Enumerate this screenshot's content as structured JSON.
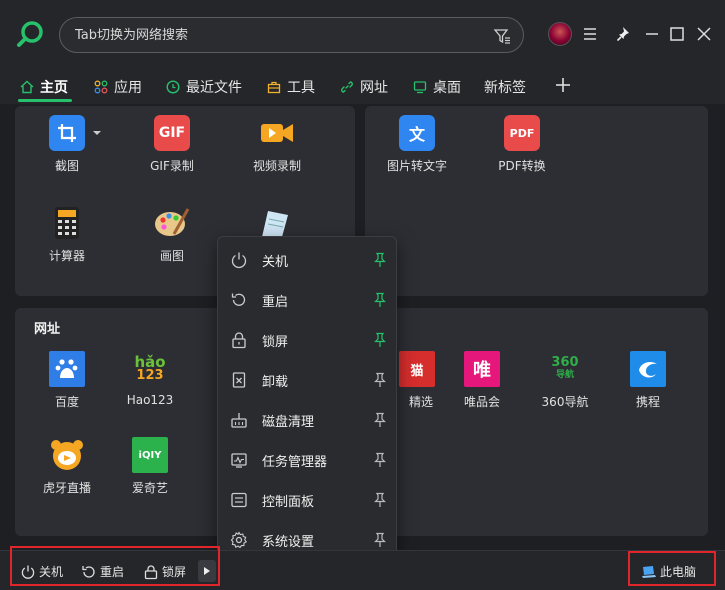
{
  "search": {
    "placeholder": "Tab切换为网络搜索"
  },
  "tabs": [
    {
      "label": "主页",
      "icon": "home-icon"
    },
    {
      "label": "应用",
      "icon": "apps-icon"
    },
    {
      "label": "最近文件",
      "icon": "clock-icon"
    },
    {
      "label": "工具",
      "icon": "toolbox-icon"
    },
    {
      "label": "网址",
      "icon": "link-icon"
    },
    {
      "label": "桌面",
      "icon": "desktop-icon"
    },
    {
      "label": "新标签"
    }
  ],
  "tools_panel": {
    "apps": [
      {
        "label": "截图",
        "icon": "crop-icon"
      },
      {
        "label": "GIF录制",
        "icon": "gif-icon",
        "badge": "GIF"
      },
      {
        "label": "视频录制",
        "icon": "video-camera-icon"
      },
      {
        "label": "计算器",
        "icon": "calculator-icon"
      },
      {
        "label": "画图",
        "icon": "palette-icon"
      }
    ]
  },
  "tools_panel_right": {
    "apps": [
      {
        "label": "图片转文字",
        "icon": "image-to-text-icon",
        "badge": "文"
      },
      {
        "label": "PDF转换",
        "icon": "pdf-icon",
        "badge": "PDF"
      }
    ]
  },
  "websites": {
    "title": "网址",
    "items": [
      {
        "label": "百度",
        "icon": "baidu-icon"
      },
      {
        "label": "Hao123",
        "icon": "hao123-icon",
        "badge_top": "hǎo",
        "badge_bottom": "123"
      },
      {
        "label": "精选",
        "icon": "tmall-icon",
        "badge": "猫"
      },
      {
        "label": "唯品会",
        "icon": "vip-icon",
        "badge": "唯"
      },
      {
        "label": "360导航",
        "icon": "360-nav-icon",
        "badge_top": "360",
        "badge_bottom": "导航"
      },
      {
        "label": "携程",
        "icon": "ctrip-icon"
      },
      {
        "label": "虎牙直播",
        "icon": "huya-icon"
      },
      {
        "label": "爱奇艺",
        "icon": "iqiyi-icon",
        "badge": "iQIY"
      }
    ]
  },
  "power_menu": {
    "items": [
      {
        "label": "关机",
        "icon": "power-icon",
        "pinned": true
      },
      {
        "label": "重启",
        "icon": "restart-icon",
        "pinned": true
      },
      {
        "label": "锁屏",
        "icon": "lock-icon",
        "pinned": true
      },
      {
        "label": "卸载",
        "icon": "uninstall-icon",
        "pinned": false
      },
      {
        "label": "磁盘清理",
        "icon": "disk-clean-icon",
        "pinned": false
      },
      {
        "label": "任务管理器",
        "icon": "task-manager-icon",
        "pinned": false
      },
      {
        "label": "控制面板",
        "icon": "control-panel-icon",
        "pinned": false
      },
      {
        "label": "系统设置",
        "icon": "settings-icon",
        "pinned": false
      }
    ]
  },
  "bottom_bar": {
    "shutdown": "关机",
    "restart": "重启",
    "lock": "锁屏",
    "this_pc": "此电脑"
  },
  "colors": {
    "accent": "#27c06b",
    "highlight": "#e0262a",
    "background": "#1e1f22",
    "panel": "#2d2e33"
  }
}
